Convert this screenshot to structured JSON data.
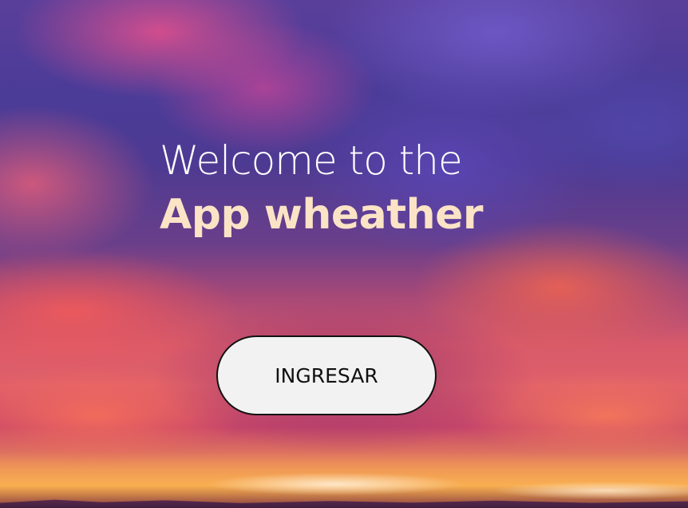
{
  "welcome": {
    "line1": "Welcome to the",
    "line2": "App wheather"
  },
  "actions": {
    "enter_label": "INGRESAR"
  },
  "colors": {
    "title_primary": "#ffffff",
    "title_accent": "#fbe3c6",
    "button_background": "#f2f2f2",
    "button_border": "#111111"
  }
}
